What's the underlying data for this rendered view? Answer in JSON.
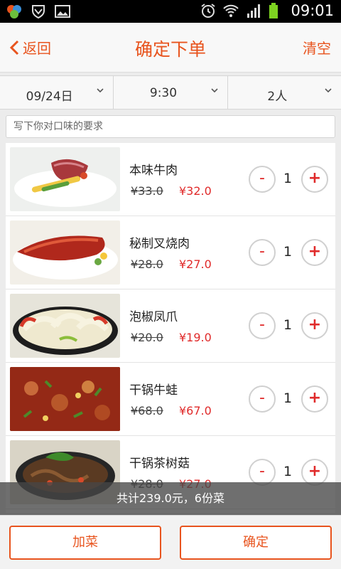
{
  "status_bar": {
    "time": "09:01"
  },
  "header": {
    "back_label": "返回",
    "title": "确定下单",
    "clear_label": "清空"
  },
  "selectors": {
    "date": "09/24日",
    "time": "9:30",
    "people": "2人"
  },
  "note": {
    "placeholder": "写下你对口味的要求"
  },
  "items": [
    {
      "name": "本味牛肉",
      "old_price": "¥33.0",
      "price": "¥32.0",
      "qty": "1"
    },
    {
      "name": "秘制叉烧肉",
      "old_price": "¥28.0",
      "price": "¥27.0",
      "qty": "1"
    },
    {
      "name": "泡椒凤爪",
      "old_price": "¥20.0",
      "price": "¥19.0",
      "qty": "1"
    },
    {
      "name": "干锅牛蛙",
      "old_price": "¥68.0",
      "price": "¥67.0",
      "qty": "1"
    },
    {
      "name": "干锅茶树菇",
      "old_price": "¥28.0",
      "price": "¥27.0",
      "qty": "1"
    }
  ],
  "controls": {
    "minus": "-",
    "plus": "+"
  },
  "summary": {
    "text": "共计239.0元，6份菜"
  },
  "bottom": {
    "add_label": "加菜",
    "confirm_label": "确定"
  },
  "colors": {
    "accent": "#e8541e",
    "price": "#e02a2a"
  }
}
